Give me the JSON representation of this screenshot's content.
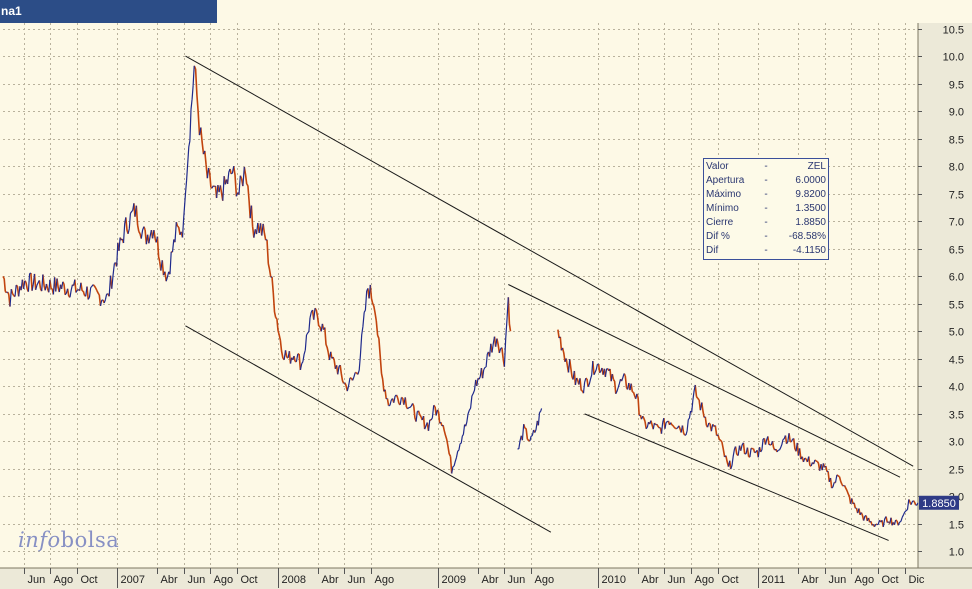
{
  "window": {
    "tab_label": "na1"
  },
  "stats_box": {
    "rows": [
      {
        "label": "Valor",
        "sep": "-",
        "value": "ZEL"
      },
      {
        "label": "Apertura",
        "sep": "-",
        "value": "6.0000"
      },
      {
        "label": "Máximo",
        "sep": "-",
        "value": "9.8200"
      },
      {
        "label": "Mínimo",
        "sep": "-",
        "value": "1.3500"
      },
      {
        "label": "Cierre",
        "sep": "-",
        "value": "1.8850"
      },
      {
        "label": "Dif %",
        "sep": "-",
        "value": "-68.58%"
      },
      {
        "label": "Dif",
        "sep": "-",
        "value": "-4.1150"
      }
    ]
  },
  "logo": {
    "part1": "info",
    "part2": "bolsa"
  },
  "colors": {
    "plot_bg": "#fdf9e6",
    "grid": "#b9b29d",
    "series_up": "#1f2a8c",
    "series_down": "#c1440e",
    "channel": "#1a1a1a",
    "price_tag_bg": "#2e3a86"
  },
  "chart_data": {
    "type": "line",
    "title": "",
    "xlabel": "",
    "ylabel": "",
    "ylim": [
      0.7,
      10.6
    ],
    "yticks": [
      1.0,
      1.5,
      2.0,
      2.5,
      3.0,
      3.5,
      4.0,
      4.5,
      5.0,
      5.5,
      6.0,
      6.5,
      7.0,
      7.5,
      8.0,
      8.5,
      9.0,
      9.5,
      10.0,
      10.5
    ],
    "last_price_label": "1.8850",
    "last_price": 1.885,
    "grid": true,
    "xlim": [
      "2006-04-15",
      "2011-12-31"
    ],
    "xticks": [
      {
        "date": "2006-06-01",
        "label": "Jun"
      },
      {
        "date": "2006-08-01",
        "label": "Ago"
      },
      {
        "date": "2006-10-01",
        "label": "Oct"
      },
      {
        "date": "2007-01-01",
        "label": "2007",
        "major": true
      },
      {
        "date": "2007-04-01",
        "label": "Abr"
      },
      {
        "date": "2007-06-01",
        "label": "Jun"
      },
      {
        "date": "2007-08-01",
        "label": "Ago"
      },
      {
        "date": "2007-10-01",
        "label": "Oct"
      },
      {
        "date": "2008-01-01",
        "label": "2008",
        "major": true
      },
      {
        "date": "2008-04-01",
        "label": "Abr"
      },
      {
        "date": "2008-06-01",
        "label": "Jun"
      },
      {
        "date": "2008-08-01",
        "label": "Ago"
      },
      {
        "date": "2009-01-01",
        "label": "2009",
        "major": true
      },
      {
        "date": "2009-04-01",
        "label": "Abr"
      },
      {
        "date": "2009-06-01",
        "label": "Jun"
      },
      {
        "date": "2009-08-01",
        "label": "Ago"
      },
      {
        "date": "2010-01-01",
        "label": "2010",
        "major": true
      },
      {
        "date": "2010-04-01",
        "label": "Abr"
      },
      {
        "date": "2010-06-01",
        "label": "Jun"
      },
      {
        "date": "2010-08-01",
        "label": "Ago"
      },
      {
        "date": "2010-10-01",
        "label": "Oct"
      },
      {
        "date": "2011-01-01",
        "label": "2011",
        "major": true
      },
      {
        "date": "2011-04-01",
        "label": "Abr"
      },
      {
        "date": "2011-06-01",
        "label": "Jun"
      },
      {
        "date": "2011-08-01",
        "label": "Ago"
      },
      {
        "date": "2011-10-01",
        "label": "Oct"
      },
      {
        "date": "2011-12-01",
        "label": "Dic"
      }
    ],
    "series": [
      {
        "x": [
          "2006-04-15",
          "2006-05-01",
          "2006-06-01",
          "2006-07-15",
          "2006-09-01",
          "2006-10-15",
          "2006-11-15",
          "2006-12-10",
          "2006-12-25",
          "2007-01-20",
          "2007-02-10",
          "2007-03-05",
          "2007-03-25",
          "2007-04-10",
          "2007-04-25",
          "2007-05-15",
          "2007-06-01",
          "2007-06-05",
          "2007-06-15",
          "2007-06-25",
          "2007-07-10",
          "2007-07-25",
          "2007-08-15",
          "2007-09-01",
          "2007-09-20",
          "2007-10-05",
          "2007-10-20",
          "2007-11-05",
          "2007-11-20",
          "2007-12-05",
          "2007-12-25",
          "2008-01-10",
          "2008-01-25",
          "2008-02-10",
          "2008-02-25",
          "2008-03-15",
          "2008-04-01",
          "2008-04-15",
          "2008-05-01",
          "2008-05-20",
          "2008-06-05",
          "2008-06-20",
          "2008-07-05",
          "2008-07-25",
          "2008-08-10",
          "2008-08-25",
          "2008-09-10",
          "2008-09-25",
          "2008-10-15",
          "2008-11-01",
          "2008-11-20",
          "2008-12-10",
          "2008-12-25",
          "2009-01-15",
          "2009-02-01",
          "2009-02-20",
          "2009-03-10",
          "2009-03-25",
          "2009-04-15",
          "2009-05-01",
          "2009-05-15",
          "2009-06-01",
          "2009-06-10",
          "2009-06-15"
        ],
        "values": [
          6.0,
          5.6,
          5.9,
          5.85,
          5.8,
          5.75,
          5.65,
          5.6,
          6.2,
          6.9,
          7.2,
          6.7,
          6.9,
          6.3,
          6.0,
          6.8,
          6.9,
          7.7,
          8.7,
          9.8,
          8.5,
          7.8,
          7.4,
          7.6,
          7.9,
          7.5,
          8.0,
          6.9,
          6.9,
          6.7,
          5.5,
          4.7,
          4.5,
          4.6,
          4.4,
          5.2,
          5.3,
          5.0,
          4.5,
          4.3,
          4.0,
          4.1,
          4.4,
          5.8,
          5.5,
          4.2,
          3.7,
          3.8,
          3.8,
          3.6,
          3.4,
          3.3,
          3.6,
          3.3,
          2.5,
          3.0,
          3.4,
          4.0,
          4.3,
          4.7,
          4.9,
          4.5,
          5.6,
          5.0
        ]
      },
      {
        "x": [
          "2009-07-01",
          "2009-07-15",
          "2009-08-01",
          "2009-08-15",
          "2009-08-25"
        ],
        "values": [
          2.8,
          3.2,
          3.0,
          3.3,
          3.6
        ]
      },
      {
        "x": [
          "2009-10-01",
          "2009-10-20",
          "2009-11-10",
          "2009-12-01",
          "2009-12-25",
          "2010-01-20",
          "2010-02-10",
          "2010-03-01",
          "2010-03-25",
          "2010-04-15",
          "2010-05-01",
          "2010-05-20",
          "2010-06-10",
          "2010-07-01",
          "2010-07-20",
          "2010-08-10",
          "2010-08-25",
          "2010-09-10",
          "2010-09-25",
          "2010-10-10",
          "2010-10-25",
          "2010-11-10",
          "2010-11-25",
          "2010-12-10",
          "2011-01-01",
          "2011-01-20",
          "2011-02-10",
          "2011-03-01",
          "2011-03-20",
          "2011-04-05",
          "2011-04-20",
          "2011-05-10",
          "2011-06-01",
          "2011-06-20",
          "2011-07-05",
          "2011-07-25",
          "2011-08-10",
          "2011-09-01",
          "2011-09-20",
          "2011-10-10",
          "2011-10-25",
          "2011-11-10",
          "2011-11-25",
          "2011-12-10",
          "2011-12-31"
        ],
        "values": [
          5.0,
          4.5,
          4.1,
          4.0,
          4.4,
          4.3,
          4.0,
          4.1,
          3.9,
          3.3,
          3.3,
          3.2,
          3.4,
          3.3,
          3.2,
          3.9,
          3.6,
          3.3,
          3.2,
          2.9,
          2.5,
          2.8,
          2.9,
          2.8,
          2.8,
          3.1,
          2.8,
          3.1,
          3.0,
          2.8,
          2.65,
          2.6,
          2.5,
          2.2,
          2.4,
          2.0,
          1.8,
          1.6,
          1.5,
          1.5,
          1.6,
          1.5,
          1.6,
          1.9,
          1.885
        ]
      }
    ],
    "trend_lines": [
      {
        "from": [
          "2007-06-05",
          10.0
        ],
        "to": [
          "2011-12-20",
          2.55
        ]
      },
      {
        "from": [
          "2007-06-05",
          5.1
        ],
        "to": [
          "2009-09-15",
          1.35
        ]
      },
      {
        "from": [
          "2009-06-10",
          5.85
        ],
        "to": [
          "2011-11-20",
          2.35
        ]
      },
      {
        "from": [
          "2009-12-01",
          3.5
        ],
        "to": [
          "2011-10-25",
          1.2
        ]
      }
    ]
  }
}
